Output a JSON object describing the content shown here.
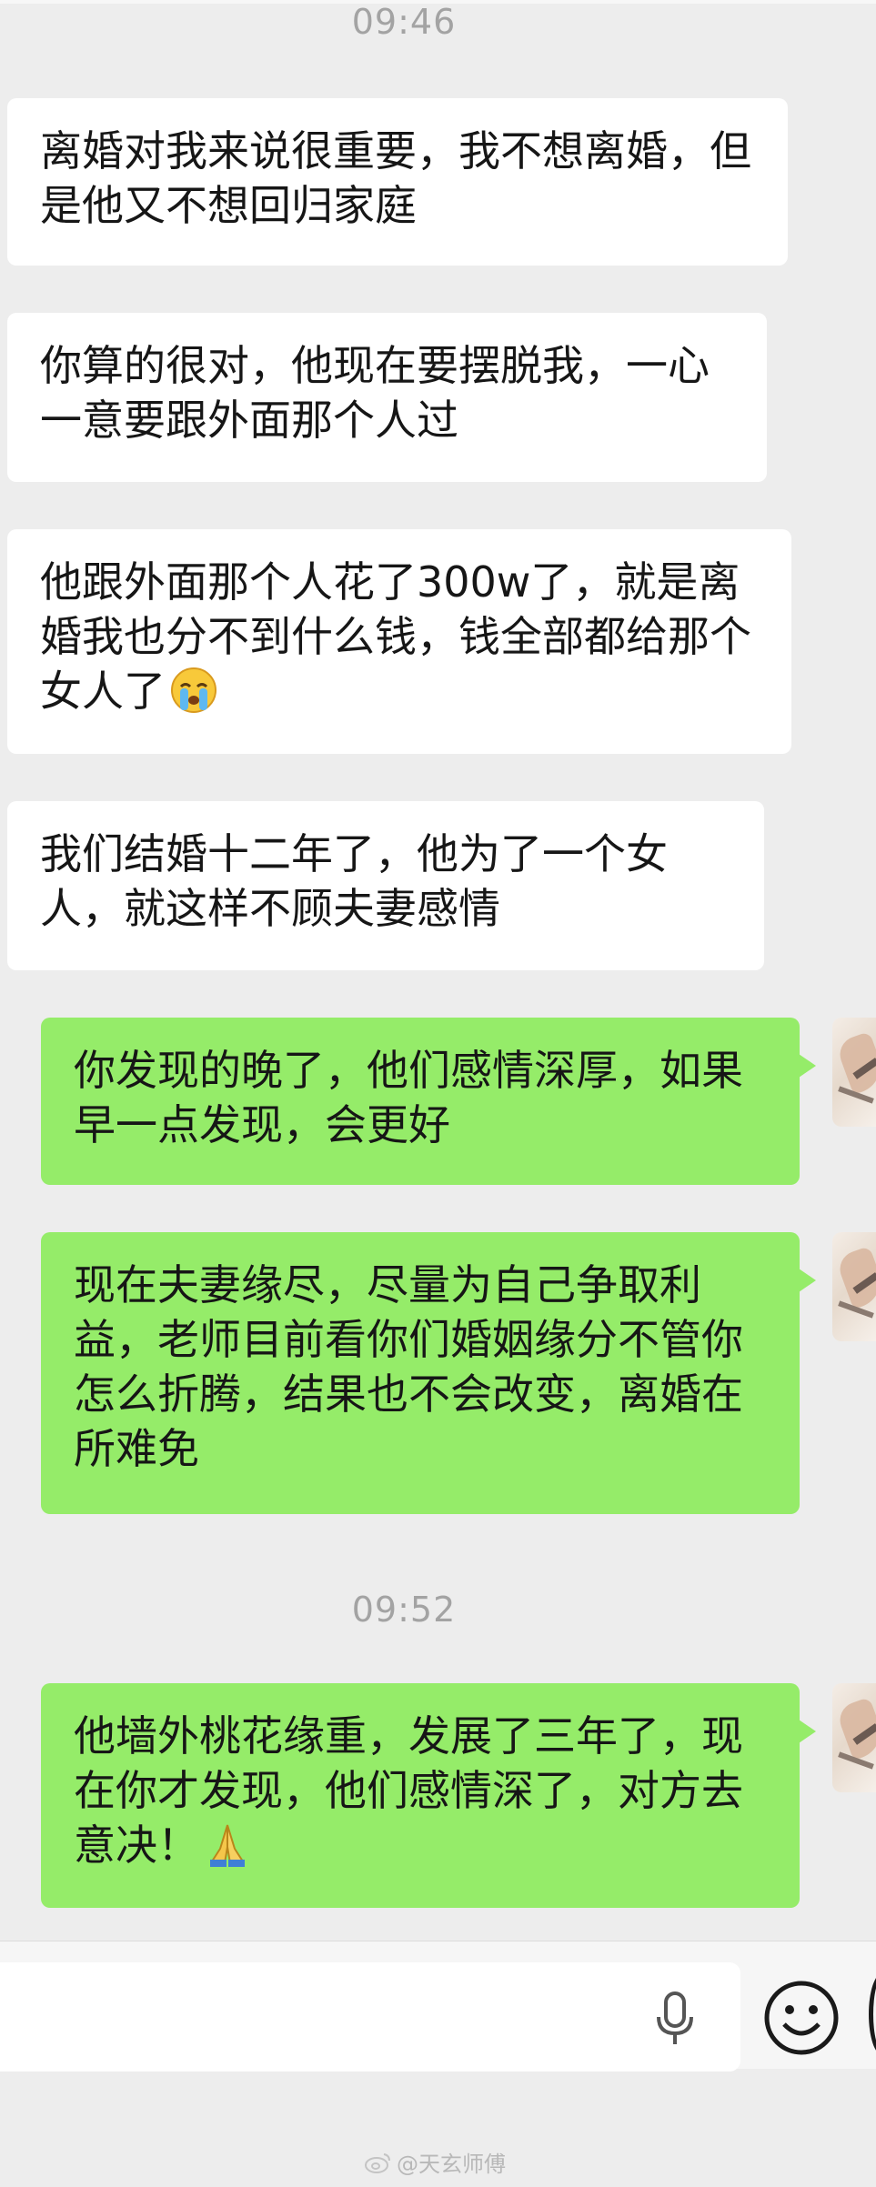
{
  "timestamps": [
    "09:46",
    "09:52"
  ],
  "messages": {
    "m1": "离婚对我来说很重要，我不想离婚，但是他又不想回归家庭",
    "m2": "你算的很对，他现在要摆脱我，一心一意要跟外面那个人过",
    "m3": "他跟外面那个人花了300w了，就是离婚我也分不到什么钱，钱全部都给那个女人了",
    "m4": "我们结婚十二年了，他为了一个女人，就这样不顾夫妻感情",
    "m5": "你发现的晚了，他们感情深厚，如果早一点发现，会更好",
    "m6": "现在夫妻缘尽，尽量为自己争取利益，老师目前看你们婚姻缘分不管你怎么折腾，结果也不会改变，离婚在所难免",
    "m7": "他墙外桃花缘重，发展了三年了，现在你才发现，他们感情深了，对方去意决！"
  },
  "emojis": {
    "m3": "crying-face-emoji",
    "m7": "folded-hands-emoji"
  },
  "input": {
    "placeholder": ""
  },
  "icons": [
    "microphone-icon",
    "smiley-icon",
    "plus-icon"
  ],
  "watermark": {
    "text": "@天玄师傅"
  },
  "colors": {
    "background": "#ededed",
    "incoming_bubble": "#ffffff",
    "outgoing_bubble": "#95ec69",
    "timestamp": "#a3a3a3"
  }
}
